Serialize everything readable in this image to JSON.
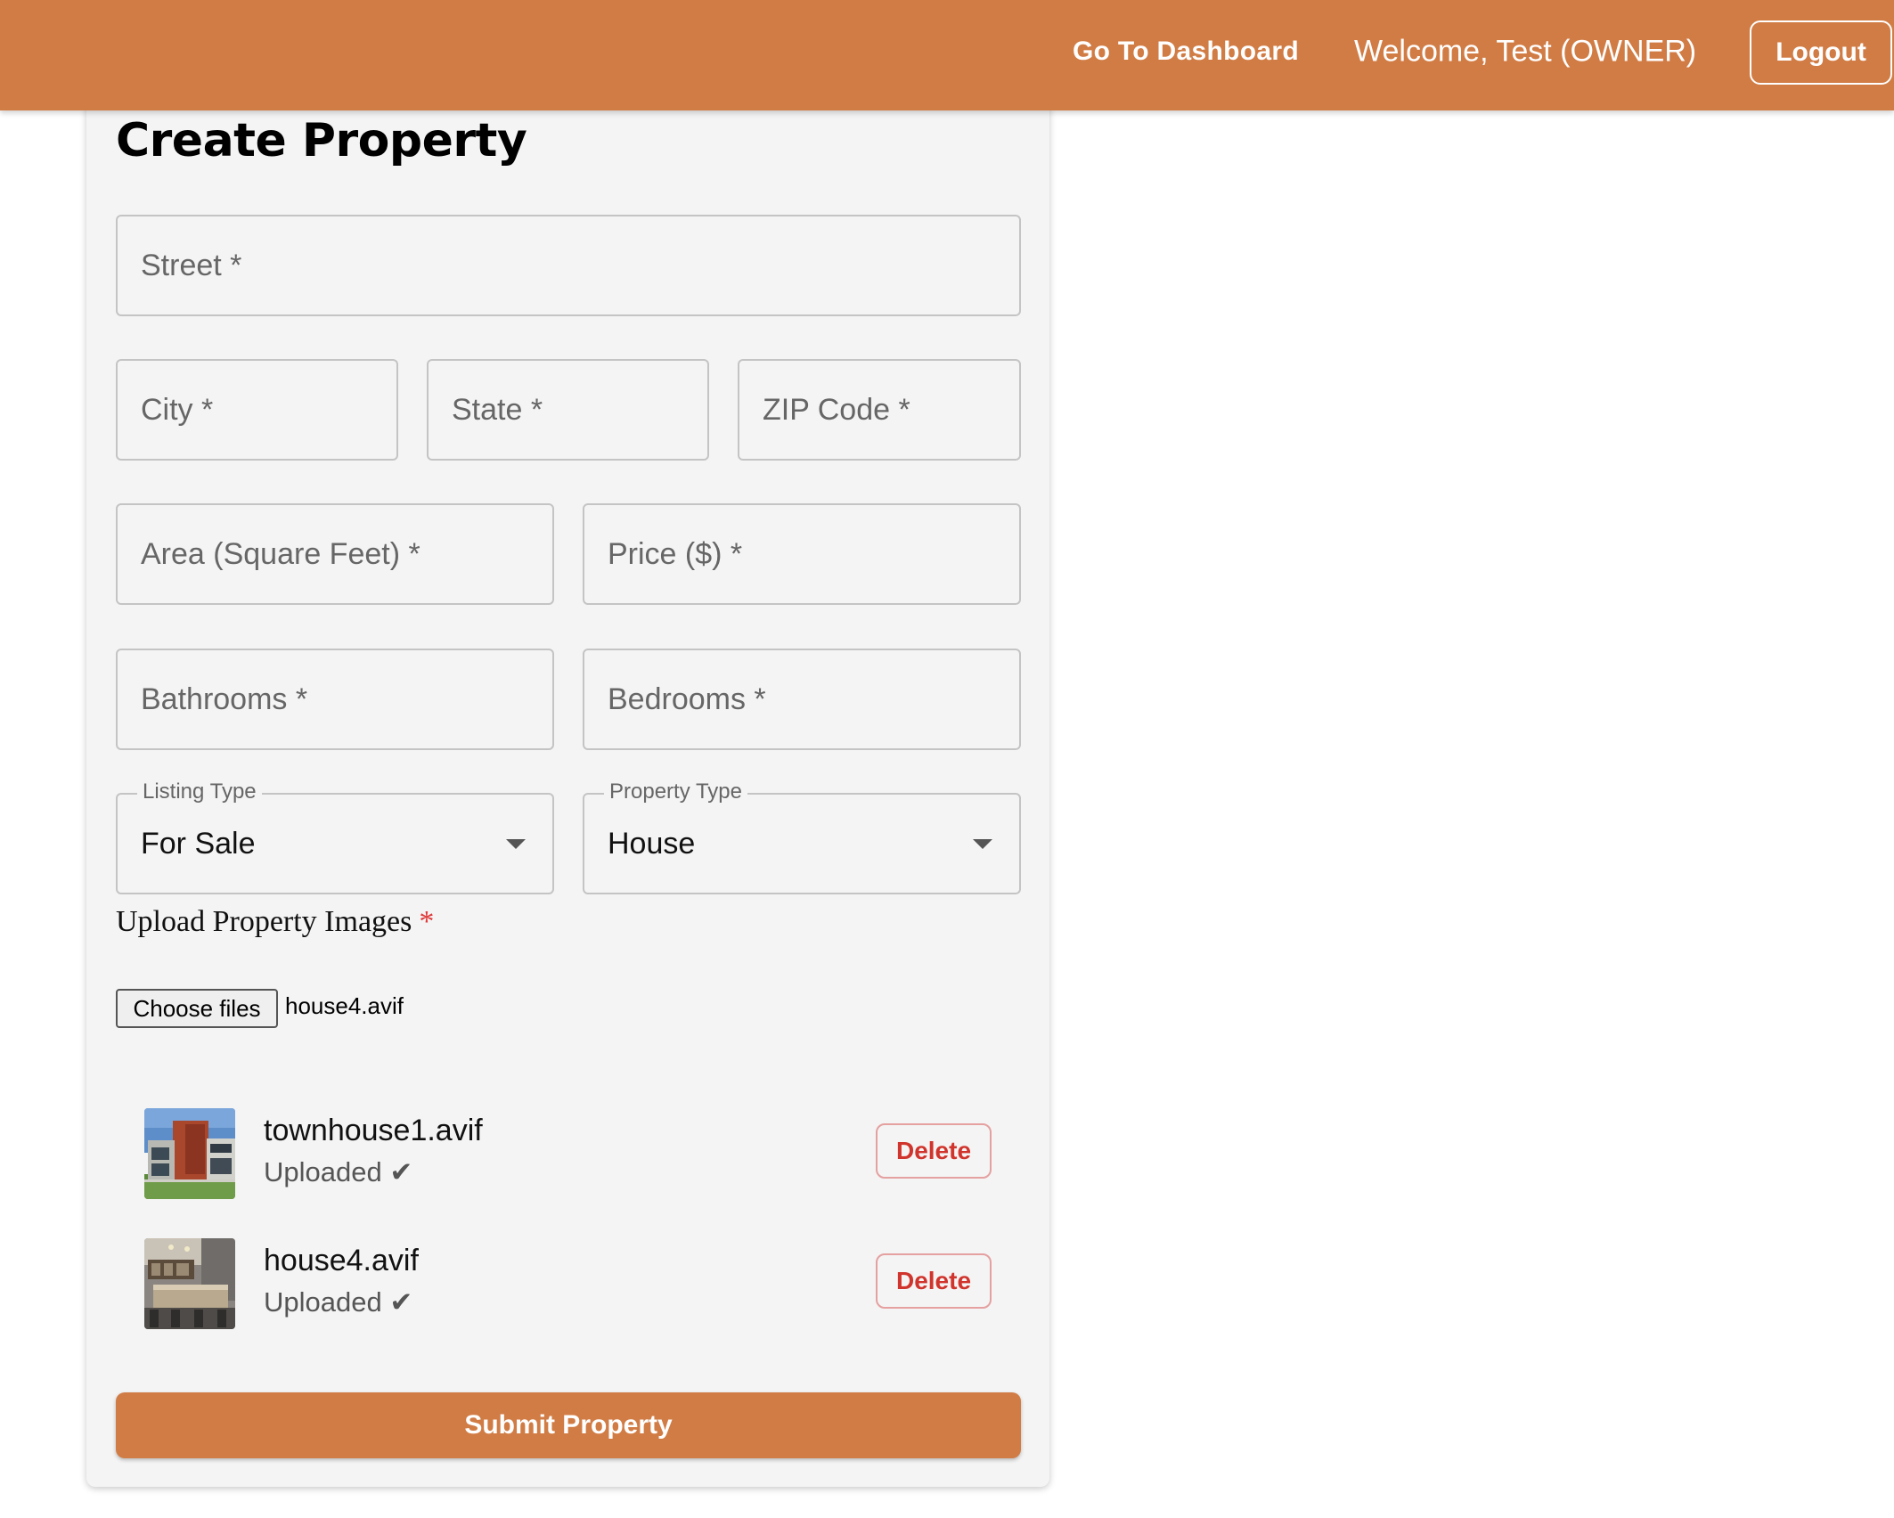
{
  "header": {
    "dashboard_link": "Go To Dashboard",
    "welcome_text": "Welcome, Test (OWNER)",
    "logout_label": "Logout",
    "bar_color": "#d17c45"
  },
  "form": {
    "title": "Create Property",
    "fields": {
      "street": "Street *",
      "city": "City *",
      "state": "State *",
      "zip": "ZIP Code *",
      "area": "Area (Square Feet) *",
      "price": "Price ($) *",
      "bathrooms": "Bathrooms *",
      "bedrooms": "Bedrooms *"
    },
    "listing_type": {
      "label": "Listing Type",
      "value": "For Sale"
    },
    "property_type": {
      "label": "Property Type",
      "value": "House"
    },
    "upload": {
      "label": "Upload Property Images",
      "required_mark": "*",
      "choose_button": "Choose files",
      "chosen_file": "house4.avif"
    },
    "images": [
      {
        "name": "townhouse1.avif",
        "status": "Uploaded ✔",
        "delete_label": "Delete",
        "thumb_icon": "townhouse-thumbnail"
      },
      {
        "name": "house4.avif",
        "status": "Uploaded ✔",
        "delete_label": "Delete",
        "thumb_icon": "kitchen-thumbnail"
      }
    ],
    "submit_label": "Submit Property"
  }
}
